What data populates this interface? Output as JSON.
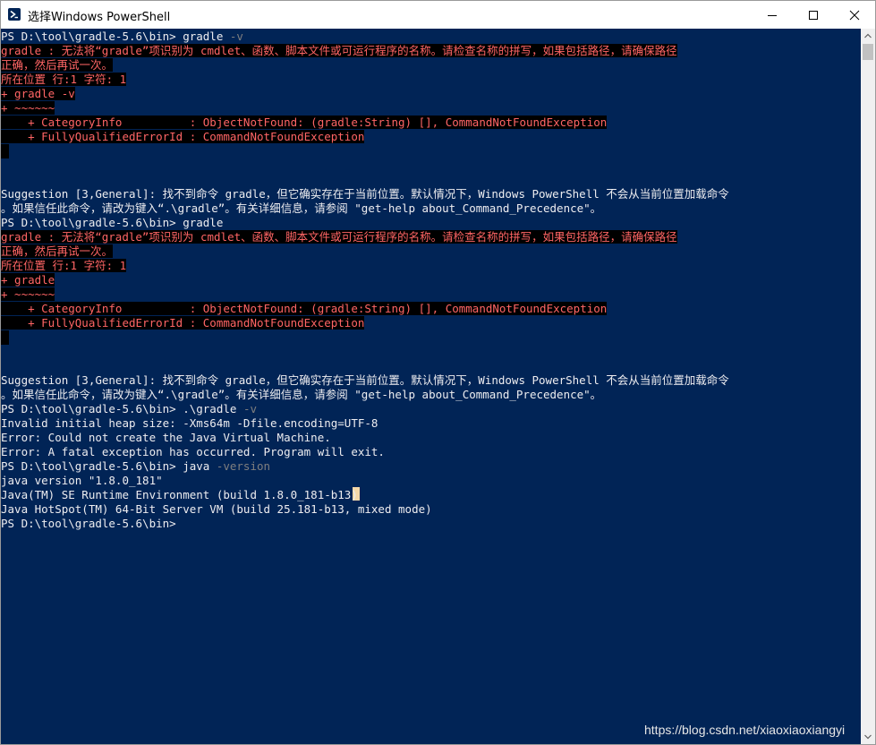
{
  "window": {
    "title": "选择Windows PowerShell",
    "icon": "powershell-icon",
    "controls": [
      "minimize-icon",
      "maximize-icon",
      "close-icon"
    ]
  },
  "colors": {
    "console_background": "#012456",
    "foreground": "#eeedf0",
    "error_foreground": "#ff6565",
    "error_background": "#000000",
    "parameter": "#7f7f7f",
    "cursor": "#f5d8a8"
  },
  "console": {
    "lines": [
      [
        {
          "t": "PS D:\\tool\\gradle-5.6\\bin> gradle ",
          "s": "plain"
        },
        {
          "t": "-v",
          "s": "param"
        }
      ],
      [
        {
          "t": "gradle : 无法将“gradle”项识别为 cmdlet、函数、脚本文件或可运行程序的名称。请检查名称的拼写，如果包括路径，请确保路径",
          "s": "err"
        }
      ],
      [
        {
          "t": "正确，然后再试一次。",
          "s": "err"
        }
      ],
      [
        {
          "t": "所在位置 行:1 字符: 1",
          "s": "err"
        }
      ],
      [
        {
          "t": "+ gradle -v",
          "s": "err"
        }
      ],
      [
        {
          "t": "+ ~~~~~~",
          "s": "err"
        }
      ],
      [
        {
          "t": "    + CategoryInfo          : ObjectNotFound: (gradle:String) [], CommandNotFoundException",
          "s": "err"
        }
      ],
      [
        {
          "t": "    + FullyQualifiedErrorId : CommandNotFoundException",
          "s": "err"
        }
      ],
      [
        {
          "t": "",
          "s": "bar"
        }
      ],
      [],
      [],
      [
        {
          "t": "Suggestion [3,General]: 找不到命令 gradle，但它确实存在于当前位置。默认情况下，Windows PowerShell 不会从当前位置加载命令",
          "s": "plain"
        }
      ],
      [
        {
          "t": "。如果信任此命令，请改为键入“.\\gradle”。有关详细信息，请参阅 \"get-help about_Command_Precedence\"。",
          "s": "plain"
        }
      ],
      [
        {
          "t": "PS D:\\tool\\gradle-5.6\\bin> gradle",
          "s": "plain"
        }
      ],
      [
        {
          "t": "gradle : 无法将“gradle”项识别为 cmdlet、函数、脚本文件或可运行程序的名称。请检查名称的拼写，如果包括路径，请确保路径",
          "s": "err"
        }
      ],
      [
        {
          "t": "正确，然后再试一次。",
          "s": "err"
        }
      ],
      [
        {
          "t": "所在位置 行:1 字符: 1",
          "s": "err"
        }
      ],
      [
        {
          "t": "+ gradle",
          "s": "err"
        }
      ],
      [
        {
          "t": "+ ~~~~~~",
          "s": "err"
        }
      ],
      [
        {
          "t": "    + CategoryInfo          : ObjectNotFound: (gradle:String) [], CommandNotFoundException",
          "s": "err"
        }
      ],
      [
        {
          "t": "    + FullyQualifiedErrorId : CommandNotFoundException",
          "s": "err"
        }
      ],
      [
        {
          "t": "",
          "s": "bar"
        }
      ],
      [],
      [],
      [
        {
          "t": "Suggestion [3,General]: 找不到命令 gradle，但它确实存在于当前位置。默认情况下，Windows PowerShell 不会从当前位置加载命令",
          "s": "plain"
        }
      ],
      [
        {
          "t": "。如果信任此命令，请改为键入“.\\gradle”。有关详细信息，请参阅 \"get-help about_Command_Precedence\"。",
          "s": "plain"
        }
      ],
      [
        {
          "t": "PS D:\\tool\\gradle-5.6\\bin> .\\gradle ",
          "s": "plain"
        },
        {
          "t": "-v",
          "s": "param"
        }
      ],
      [
        {
          "t": "Invalid initial heap size: -Xms64m -Dfile.encoding=UTF-8",
          "s": "plain"
        }
      ],
      [
        {
          "t": "Error: Could not create the Java Virtual Machine.",
          "s": "plain"
        }
      ],
      [
        {
          "t": "Error: A fatal exception has occurred. Program will exit.",
          "s": "plain"
        }
      ],
      [
        {
          "t": "PS D:\\tool\\gradle-5.6\\bin> java ",
          "s": "plain"
        },
        {
          "t": "-version",
          "s": "param"
        }
      ],
      [
        {
          "t": "java version \"1.8.0_181\"",
          "s": "plain"
        }
      ],
      [
        {
          "t": "Java(TM) SE Runtime Environment (build 1.8.0_181-b13)",
          "s": "plain"
        }
      ],
      [
        {
          "t": "Java HotSpot(TM) 64-Bit Server VM (build 25.181-b13, mixed mode)",
          "s": "plain"
        }
      ],
      [
        {
          "t": "PS D:\\tool\\gradle-5.6\\bin>",
          "s": "plain"
        }
      ]
    ]
  },
  "watermark": "https://blog.csdn.net/xiaoxiaoxiangyi"
}
